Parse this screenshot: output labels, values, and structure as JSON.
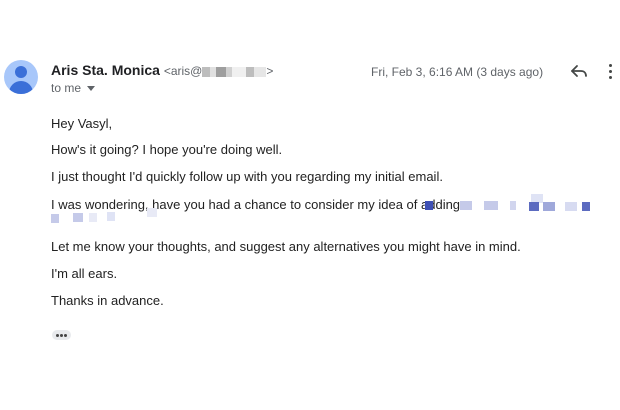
{
  "email": {
    "sender_name": "Aris Sta. Monica",
    "sender_email_prefix": "<aris@",
    "sender_email_suffix": ">",
    "recipient_label": "to me",
    "date": "Fri, Feb 3, 6:16 AM (3 days ago)",
    "body": [
      "Hey Vasyl,",
      "How's it going? I hope you're doing well.",
      "I just thought I'd quickly follow up with you regarding my initial email.",
      "I was wondering, have you had a chance to consider my idea of adding",
      "Let me know your thoughts, and suggest any alternatives you might have in mind.",
      "I'm all ears.",
      "Thanks in advance."
    ]
  },
  "icons": {
    "avatar": "person-avatar-icon",
    "reply": "reply-icon",
    "more": "more-vertical-icon",
    "expand": "trimmed-content-icon"
  },
  "colors": {
    "avatar_bg": "#a8c7fa",
    "avatar_fg": "#3b6fd8",
    "redaction": "#c5cae9",
    "redaction_strong": "#3f51b5"
  }
}
